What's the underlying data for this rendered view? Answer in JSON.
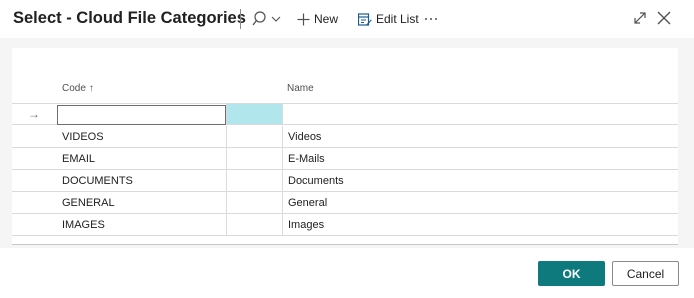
{
  "dialog": {
    "title": "Select - Cloud File Categories"
  },
  "toolbar": {
    "search_icon": "search-icon",
    "new_label": "New",
    "edit_list_label": "Edit List",
    "more_label": "···"
  },
  "grid": {
    "columns": {
      "code": "Code",
      "code_sort": "↑",
      "name": "Name"
    },
    "new_row": {
      "indicator": "→",
      "code_value": "",
      "name_value": ""
    },
    "rows": [
      {
        "code": "VIDEOS",
        "name": "Videos"
      },
      {
        "code": "EMAIL",
        "name": "E-Mails"
      },
      {
        "code": "DOCUMENTS",
        "name": "Documents"
      },
      {
        "code": "GENERAL",
        "name": "General"
      },
      {
        "code": "IMAGES",
        "name": "Images"
      }
    ]
  },
  "footer": {
    "ok_label": "OK",
    "cancel_label": "Cancel"
  },
  "colors": {
    "primary": "#0f7a7e",
    "active_cell": "#b1e6ec"
  }
}
